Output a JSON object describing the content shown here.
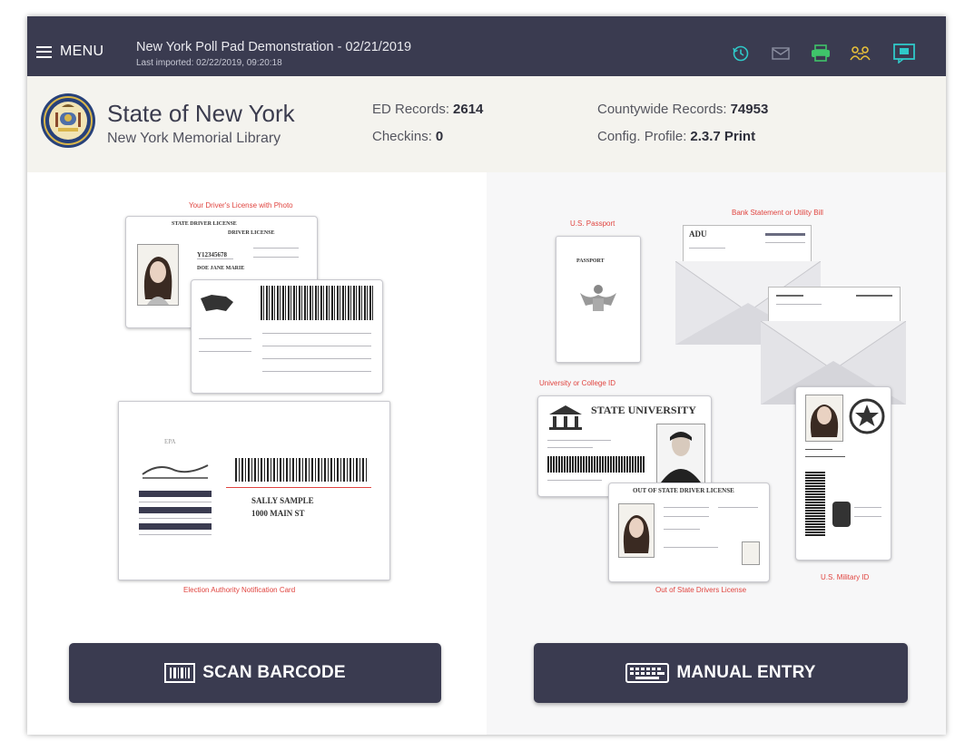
{
  "header": {
    "menu_label": "MENU",
    "title": "New York Poll Pad Demonstration - 02/21/2019",
    "subtitle": "Last imported: 02/22/2019, 09:20:18",
    "icons": [
      "history-icon",
      "mail-icon",
      "printer-icon",
      "users-icon",
      "chat-icon"
    ],
    "icon_colors": {
      "primary": "#2fc9c9",
      "printer": "#3fc46a",
      "users": "#e8c13a",
      "chat": "#2fc9c9"
    }
  },
  "info": {
    "state_name": "State of New York",
    "location": "New York Memorial Library",
    "ed_records_label": "ED Records:",
    "ed_records_value": "2614",
    "checkins_label": "Checkins:",
    "checkins_value": "0",
    "countywide_label": "Countywide Records:",
    "countywide_value": "74953",
    "config_label": "Config. Profile:",
    "config_value": "2.3.7 Print"
  },
  "left_panel": {
    "license_caption": "Your Driver's License with Photo",
    "license_title": "STATE DRIVER LICENSE",
    "license_sub": "DRIVER LICENSE",
    "license_name": "DOE JANE MARIE",
    "notification_caption": "Election Authority Notification Card",
    "sample_name": "SALLY SAMPLE",
    "sample_address": "1000 MAIN ST"
  },
  "right_panel": {
    "passport_caption": "U.S. Passport",
    "passport_title": "PASSPORT",
    "bank_caption": "Bank Statement or Utility Bill",
    "university_caption": "University or College ID",
    "university_title": "STATE UNIVERSITY",
    "out_of_state_caption": "Out of State Drivers License",
    "out_of_state_title": "OUT OF STATE DRIVER LICENSE",
    "military_caption": "U.S. Military ID"
  },
  "buttons": {
    "scan_label": "SCAN BARCODE",
    "manual_label": "MANUAL ENTRY"
  }
}
